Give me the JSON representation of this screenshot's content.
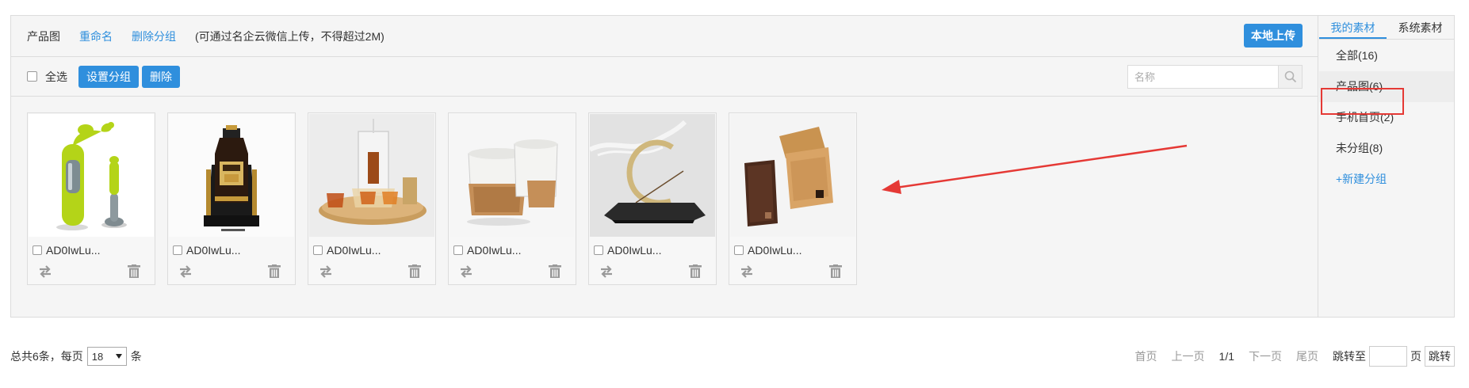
{
  "toolbar_top": {
    "group_name": "产品图",
    "rename_label": "重命名",
    "delete_group_label": "删除分组",
    "hint": "(可通过名企云微信上传，不得超过2M)",
    "upload_label": "本地上传"
  },
  "toolbar": {
    "select_all_label": "全选",
    "set_group_label": "设置分组",
    "delete_label": "删除",
    "search_placeholder": "名称"
  },
  "images": [
    {
      "name": "AD0IwLu...",
      "subject": "green-vase"
    },
    {
      "name": "AD0IwLu...",
      "subject": "liquor-bottle"
    },
    {
      "name": "AD0IwLu...",
      "subject": "tea-set"
    },
    {
      "name": "AD0IwLu...",
      "subject": "ceramic-cups"
    },
    {
      "name": "AD0IwLu...",
      "subject": "incense-holder"
    },
    {
      "name": "AD0IwLu...",
      "subject": "wooden-cases"
    }
  ],
  "sidebar": {
    "tabs": [
      {
        "label": "我的素材",
        "active": true
      },
      {
        "label": "系统素材",
        "active": false
      }
    ],
    "categories": [
      {
        "label": "全部(16)"
      },
      {
        "label": "产品图(6)",
        "selected": true
      },
      {
        "label": "手机首页(2)"
      },
      {
        "label": "未分组(8)"
      }
    ],
    "new_group_label": "+新建分组"
  },
  "footer": {
    "total_prefix": "总共6条，每页",
    "page_size": "18",
    "suffix": "条",
    "first": "首页",
    "prev": "上一页",
    "current": "1/1",
    "next": "下一页",
    "last": "尾页",
    "jump_to": "跳转至",
    "page_unit": "页",
    "jump_btn": "跳转"
  },
  "colors": {
    "accent": "#2f8fdd",
    "annotation": "#e53935"
  }
}
